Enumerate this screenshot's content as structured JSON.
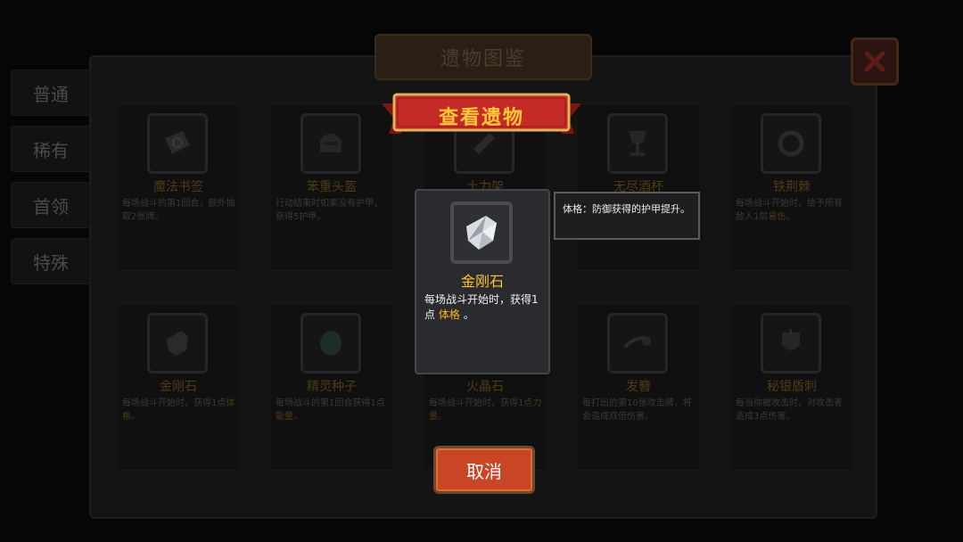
{
  "window": {
    "title": "遗物图鉴"
  },
  "tabs": [
    {
      "label": "普通"
    },
    {
      "label": "稀有"
    },
    {
      "label": "首领"
    },
    {
      "label": "特殊"
    }
  ],
  "grid": {
    "items": [
      {
        "name": "魔法书签",
        "desc": "每场战斗的第1回合，额外抽取2张牌。",
        "icon": "bookmark-icon"
      },
      {
        "name": "笨重头盔",
        "desc": "行动结束时如果没有护甲，获得5护甲。",
        "icon": "helmet-icon"
      },
      {
        "name": "土力架",
        "desc": "",
        "icon": "snack-bar-icon"
      },
      {
        "name": "无尽酒杯",
        "desc": "",
        "icon": "goblet-icon"
      },
      {
        "name": "铁荆棘",
        "desc": "每场战斗开始时，给予所有敌人1层",
        "keyword": "易伤",
        "tail": "。",
        "icon": "thorn-ring-icon"
      },
      {
        "name": "金刚石",
        "desc": "每场战斗开始时，获得1点",
        "keyword": "体格",
        "tail": "。",
        "icon": "diamond-stone-icon"
      },
      {
        "name": "精灵种子",
        "desc": "每场战斗的第1回合获得1点",
        "keyword": "能量",
        "tail": "。",
        "icon": "seed-icon"
      },
      {
        "name": "火晶石",
        "desc": "每场战斗开始时，获得1点",
        "keyword": "力量",
        "tail": "。",
        "icon": "fire-crystal-icon"
      },
      {
        "name": "发簪",
        "desc": "每打出的第10张攻击牌，将会造成双倍伤害。",
        "icon": "hairpin-icon"
      },
      {
        "name": "秘银盾刺",
        "desc": "每当你被攻击时，对攻击者造成3点伤害。",
        "icon": "spiked-shield-icon"
      }
    ]
  },
  "modal": {
    "ribbon_title": "查看遗物",
    "relic": {
      "name": "金刚石",
      "desc_prefix": "每场战斗开始时，获得1点",
      "keyword": "体格",
      "desc_suffix": "。",
      "icon": "diamond-stone-icon"
    },
    "tooltip": "体格：防御获得的护甲提升。",
    "cancel_label": "取消"
  },
  "colors": {
    "keyword": "#ffb51e",
    "relic_name": "#ffc130",
    "ribbon_red": "#c42a26",
    "cancel_red": "#c84525"
  }
}
